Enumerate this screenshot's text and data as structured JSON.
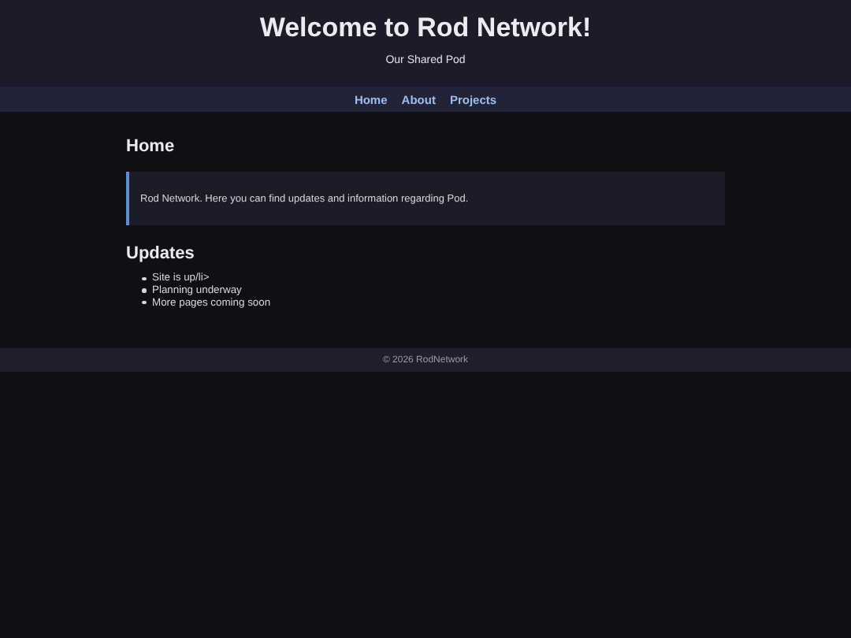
{
  "header": {
    "title": "Welcome to Rod Network!",
    "subtitle": "Our Shared Pod"
  },
  "nav": {
    "links": [
      "Home",
      "About",
      "Projects"
    ]
  },
  "home": {
    "heading": "Home",
    "intro": "Rod Network. Here you can find updates and information regarding Pod."
  },
  "updates": {
    "heading": "Updates",
    "items": [
      "Site is up/li>",
      "Planning underway",
      "More pages coming soon"
    ]
  },
  "footer": {
    "text": "© 2026 RodNetwork"
  }
}
